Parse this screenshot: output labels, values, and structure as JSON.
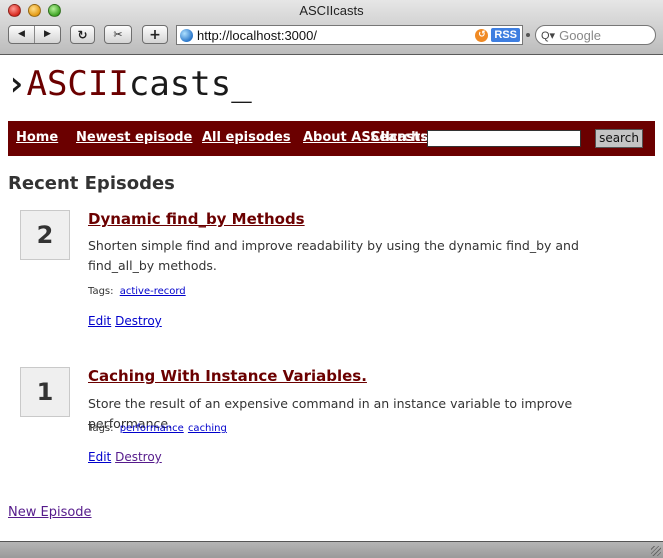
{
  "browser": {
    "window_title": "ASCIIcasts",
    "back_icon": "◀",
    "forward_icon": "▶",
    "reload_icon": "↻",
    "snip_icon": "✂",
    "add_icon": "+",
    "url": "http://localhost:3000/",
    "snapback_icon": "↺",
    "rss_label": "RSS",
    "search_placeholder": "Google",
    "search_icon": "Q▾"
  },
  "site": {
    "logo": {
      "prompt": "›",
      "part_red": "ASCII",
      "part_black": "casts",
      "cursor": "_"
    },
    "nav": [
      {
        "label": "Home"
      },
      {
        "label": "Newest episode"
      },
      {
        "label": "All episodes"
      },
      {
        "label": "About ASCIIcasts"
      }
    ],
    "search": {
      "label": "Search:",
      "value": "",
      "button_label": "search"
    },
    "colors": {
      "brand": "#6b0000",
      "link": "#0000cc",
      "visited_link": "#551a8b"
    }
  },
  "main": {
    "heading": "Recent Episodes",
    "episodes": [
      {
        "number": "2",
        "title": "Dynamic find_by Methods",
        "description": "Shorten simple find and improve readability by using the dynamic find_by and find_all_by methods.",
        "tags_label": "Tags:",
        "tags": [
          "active-record"
        ],
        "edit_label": "Edit",
        "destroy_label": "Destroy"
      },
      {
        "number": "1",
        "title": "Caching With Instance Variables.",
        "description": "Store the result of an expensive command in an instance variable to improve performance.",
        "tags_label": "Tags:",
        "tags": [
          "performance",
          "caching"
        ],
        "edit_label": "Edit",
        "destroy_label": "Destroy"
      }
    ],
    "new_episode_label": "New Episode"
  }
}
